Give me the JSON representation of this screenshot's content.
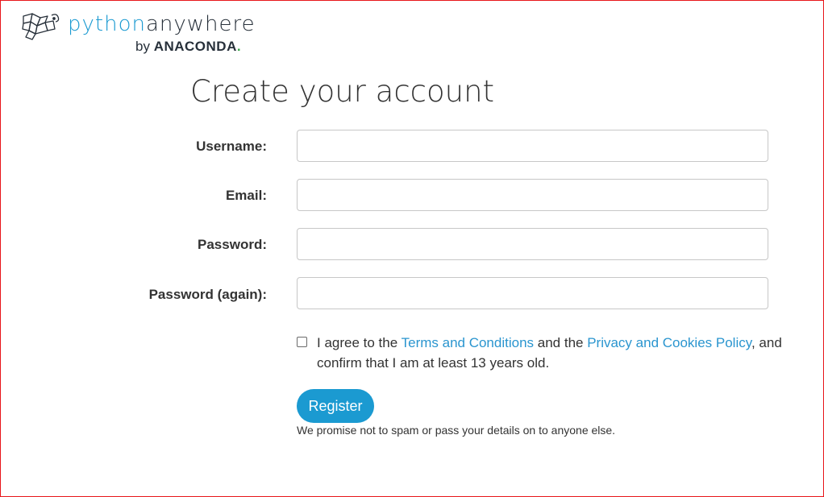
{
  "logo": {
    "icon": "pythonanywhere-logo-icon",
    "word_python": "python",
    "word_anywhere": "anywhere",
    "by": "by",
    "brand": "ANACONDA",
    "brand_dot": "."
  },
  "page": {
    "title": "Create your account"
  },
  "form": {
    "username_label": "Username:",
    "username_value": "",
    "email_label": "Email:",
    "email_value": "",
    "password_label": "Password:",
    "password_value": "",
    "password_again_label": "Password (again):",
    "password_again_value": "",
    "agree_checked": false,
    "agree_prefix": "I agree to the ",
    "terms_link": "Terms and Conditions",
    "agree_middle": " and the ",
    "privacy_link": "Privacy and Cookies Policy",
    "agree_suffix": ", and confirm that I am at least 13 years old.",
    "register_label": "Register",
    "promise_text": "We promise not to spam or pass your details on to anyone else."
  },
  "colors": {
    "accent": "#1b9ad1",
    "link": "#2a95cf",
    "frame_border": "#e8161a",
    "text": "#333333"
  }
}
